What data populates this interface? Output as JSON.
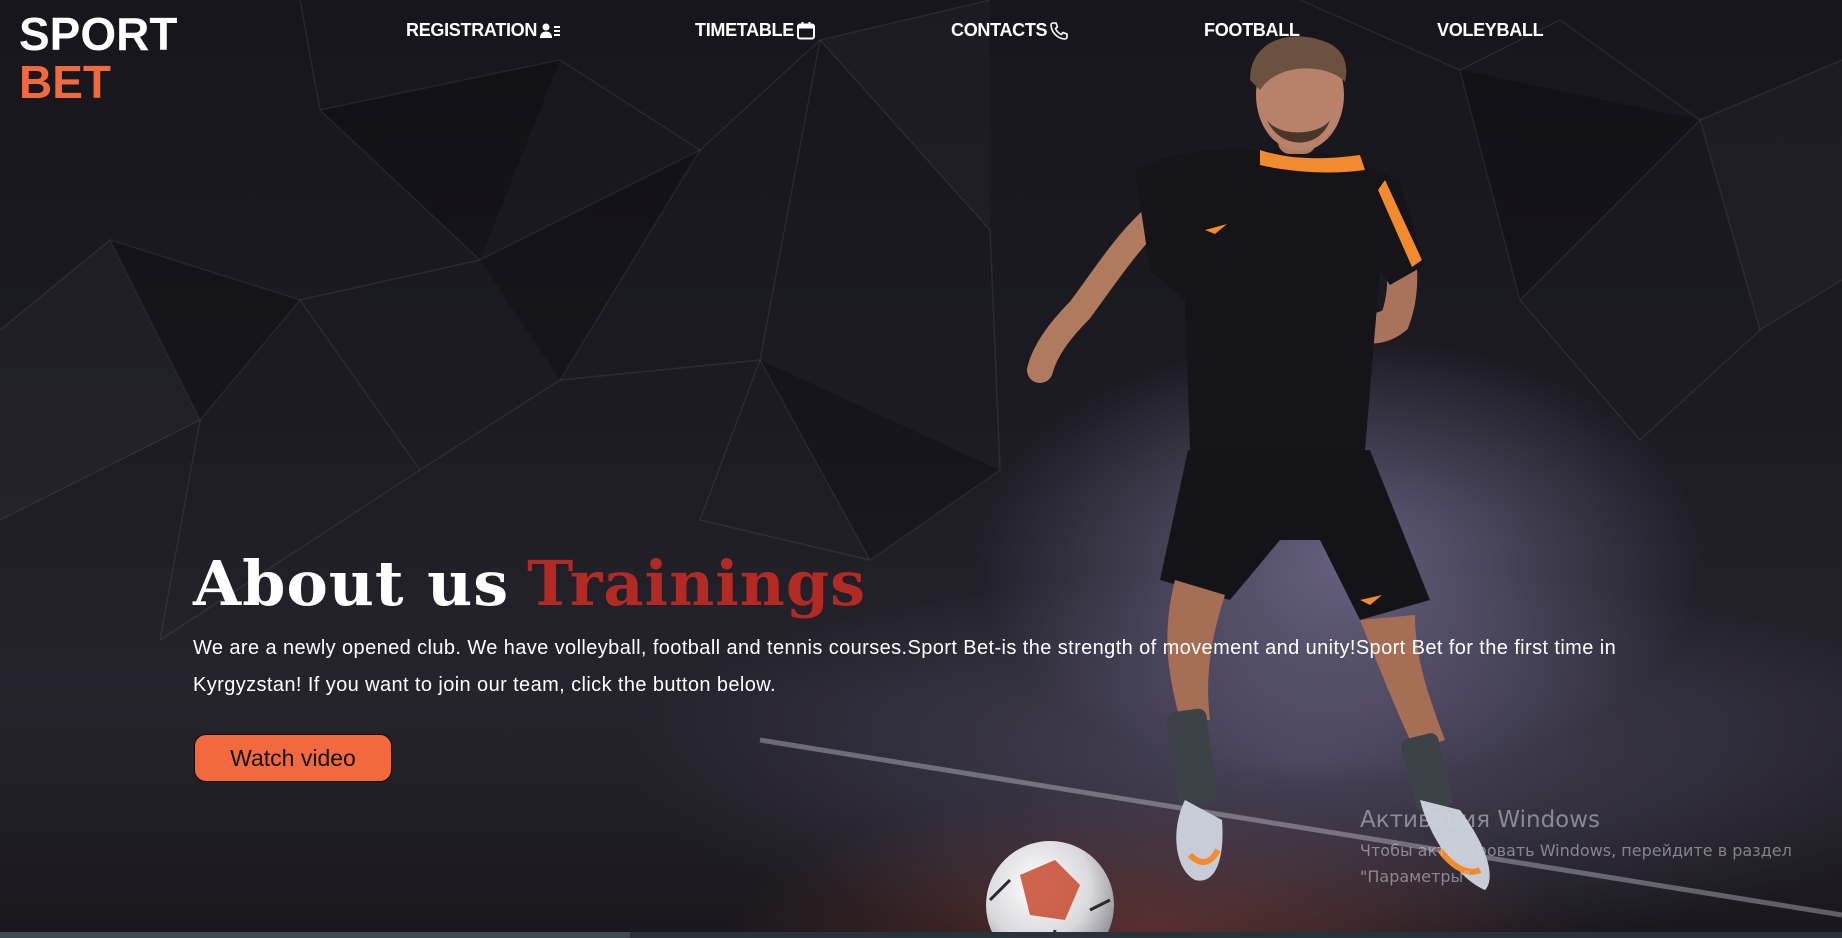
{
  "logo": {
    "line1": "SPORT",
    "line2": "BET"
  },
  "nav": [
    {
      "label": "REGISTRATION",
      "icon": "user-list-icon"
    },
    {
      "label": "TIMETABLE",
      "icon": "calendar-icon"
    },
    {
      "label": "CONTACTS",
      "icon": "phone-icon"
    },
    {
      "label": "FOOTBALL",
      "icon": ""
    },
    {
      "label": "VOLEYBALL",
      "icon": ""
    }
  ],
  "hero": {
    "title_white": "About us",
    "title_red": "Trainings",
    "description": "We are a newly opened club. We have volleyball, football and tennis courses.Sport Bet-is the strength of movement and unity!Sport Bet for the first time in Kyrgyzstan! If you want to join our team, click the button below.",
    "button_label": "Watch video"
  },
  "watermark": {
    "title": "Активация Windows",
    "subtitle": "Чтобы активировать Windows, перейдите в раздел \"Параметры\"."
  },
  "colors": {
    "accent": "#f2693e",
    "title_red": "#b22a24",
    "text": "#ffffff"
  }
}
